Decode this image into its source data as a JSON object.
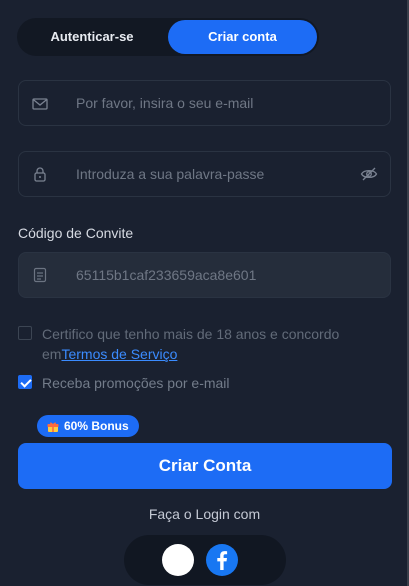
{
  "tabs": {
    "login_label": "Autenticar-se",
    "signup_label": "Criar conta"
  },
  "email": {
    "placeholder": "Por favor, insira o seu e-mail"
  },
  "password": {
    "placeholder": "Introduza a sua palavra-passe"
  },
  "invite": {
    "label": "Código de Convite",
    "value": "65115b1caf233659aca8e601"
  },
  "age_terms": {
    "text_before": "Certifico que tenho mais de 18 anos e concordo",
    "text_em": "em",
    "link": "Termos de Serviço",
    "checked": false
  },
  "promo": {
    "text": "Receba promoções por e-mail",
    "checked": true
  },
  "bonus_badge": "60% Bonus",
  "submit_label": "Criar Conta",
  "social": {
    "title": "Faça o Login com"
  },
  "colors": {
    "accent": "#1d6cf5",
    "background": "#1a2130",
    "link": "#3b8cff"
  }
}
